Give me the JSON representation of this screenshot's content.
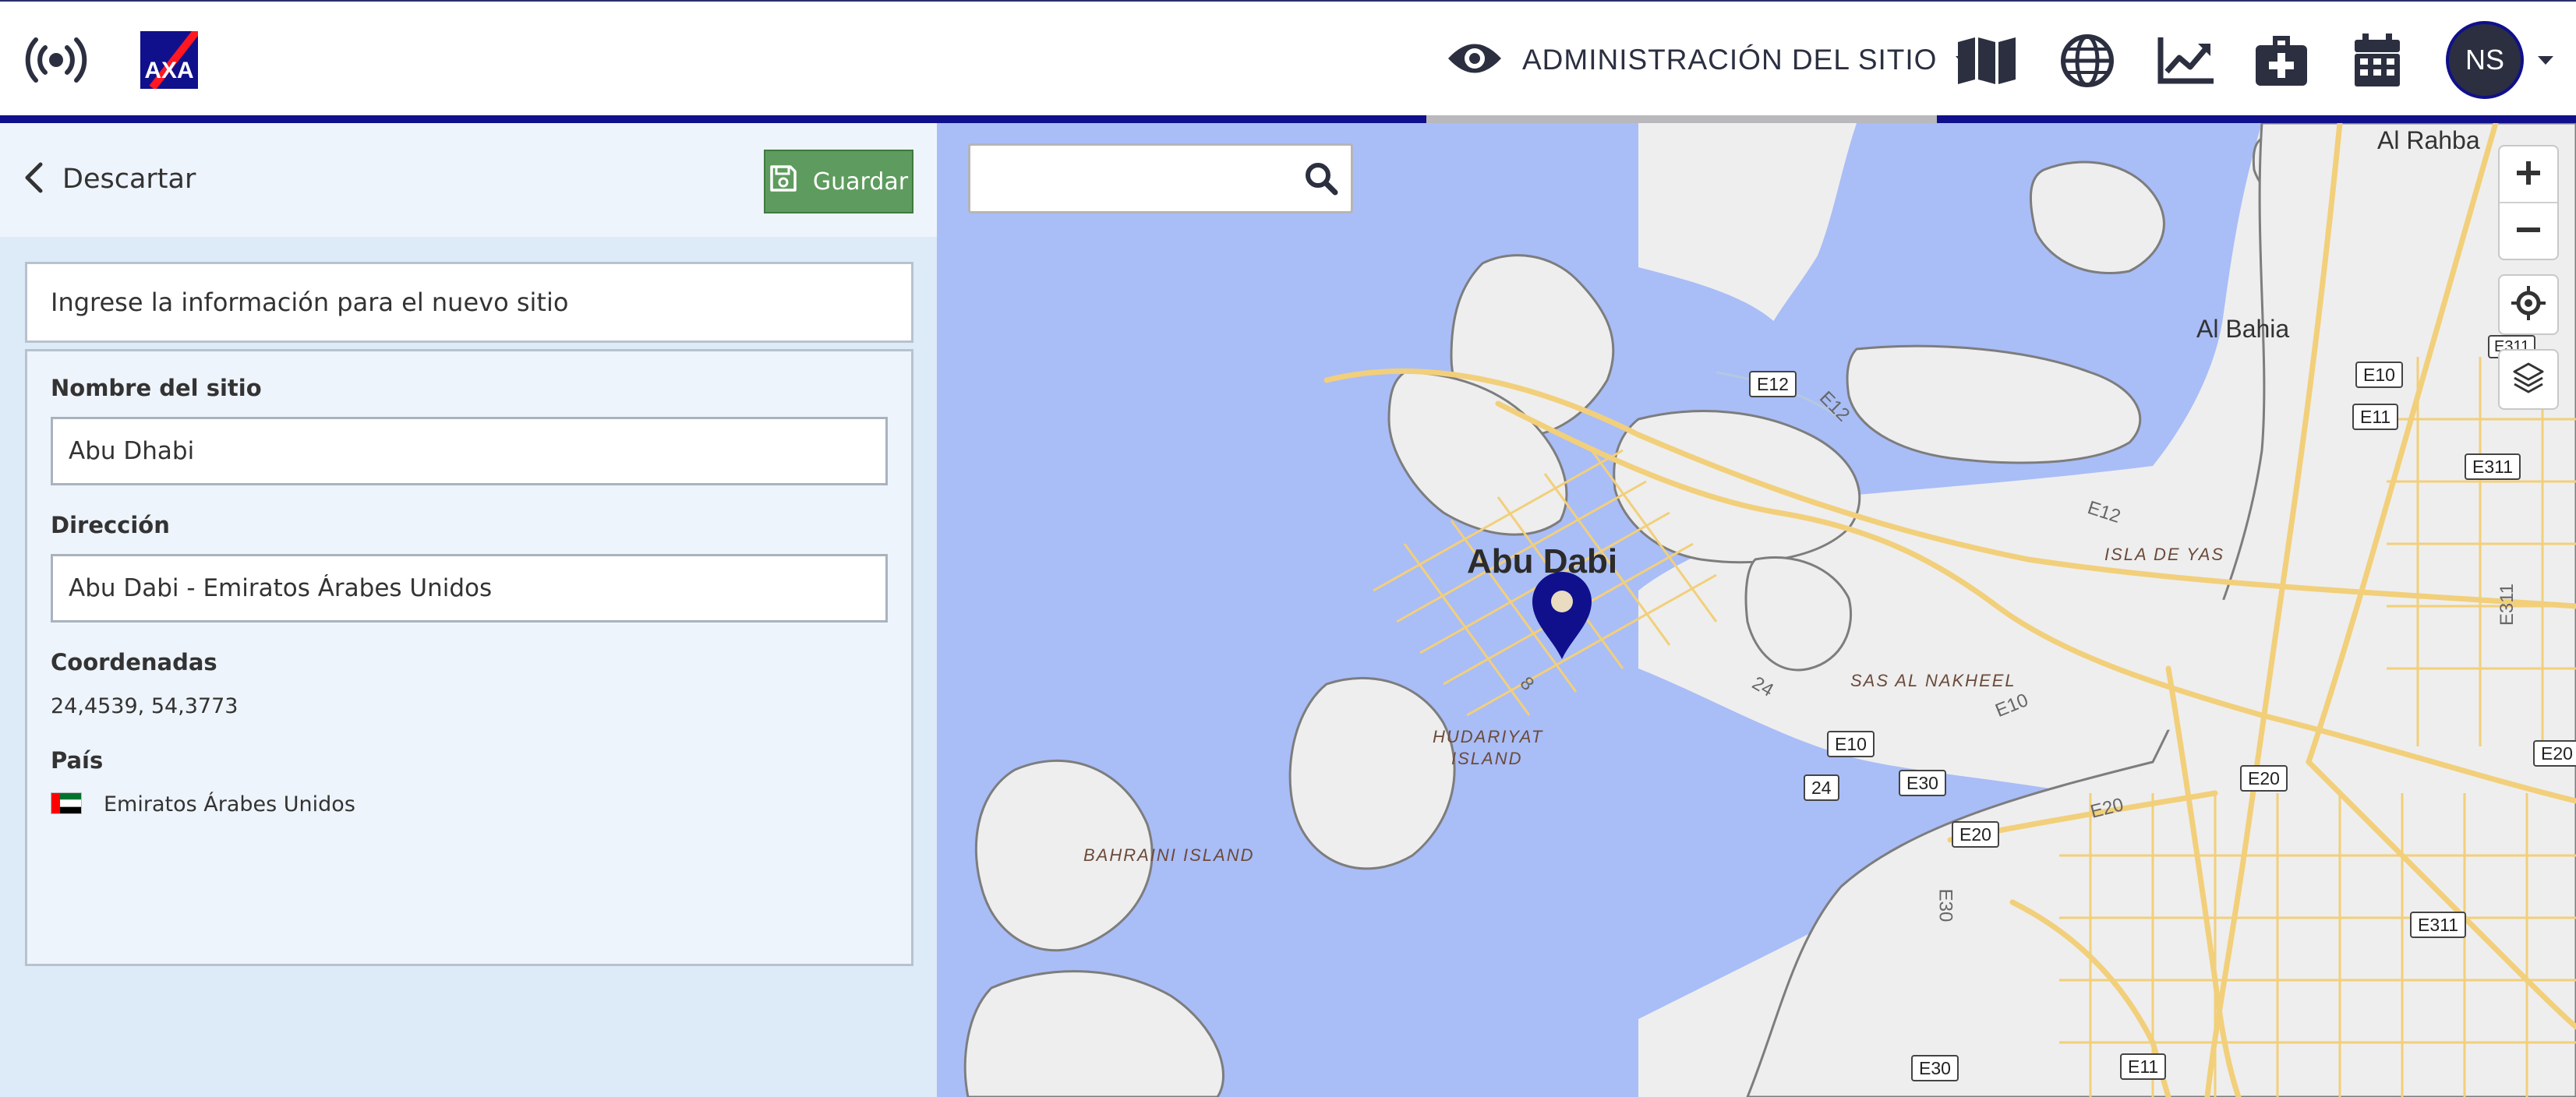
{
  "header": {
    "admin_label": "ADMINISTRACIÓN DEL SITIO",
    "user_initials": "NS",
    "logo_text": "AXA",
    "accent_color": "#10108c",
    "nav_icons": [
      "broadcast-icon",
      "map-icon",
      "globe-icon",
      "chart-line-icon",
      "medical-kit-icon",
      "calendar-icon"
    ]
  },
  "panel": {
    "discard_label": "Descartar",
    "save_label": "Guardar",
    "intro_text": "Ingrese la información para el nuevo sitio",
    "site_name_label": "Nombre del sitio",
    "site_name_value": "Abu Dhabi",
    "address_label": "Dirección",
    "address_value": "Abu Dabi - Emiratos Árabes Unidos",
    "coords_label": "Coordenadas",
    "coords_value": "24,4539, 54,3773",
    "country_label": "País",
    "country_value": "Emiratos Árabes Unidos"
  },
  "map": {
    "search_placeholder": "",
    "city_label": "Abu Dabi",
    "places": {
      "al_rahba": "Al Rahba",
      "al_bahia": "Al Bahia",
      "isla_de_yas": "ISLA DE YAS",
      "sas_al_nakheel": "SAS AL NAKHEEL",
      "hudariyat_1": "HUDARIYAT",
      "hudariyat_2": "ISLAND",
      "bahraini": "BAHRAINI ISLAND"
    },
    "roads": {
      "e12_a": "E12",
      "e12_b": "E12",
      "e12_c": "E12",
      "e10_a": "E10",
      "e10_b": "E10",
      "e10_c": "E10",
      "e11_a": "E11",
      "e11_b": "E11",
      "e311_a": "E311",
      "e311_b": "E311",
      "e311_c": "E311",
      "e311_d": "E311",
      "e20_a": "E20",
      "e20_b": "E20",
      "e20_c": "E20",
      "e20_d": "E20",
      "e30_a": "E30",
      "e30_b": "E30",
      "e30_c": "E30",
      "r24_a": "24",
      "r24_b": "24",
      "r8": "8"
    },
    "water_color": "#a9bdf7",
    "pin_color": "#10108c"
  }
}
